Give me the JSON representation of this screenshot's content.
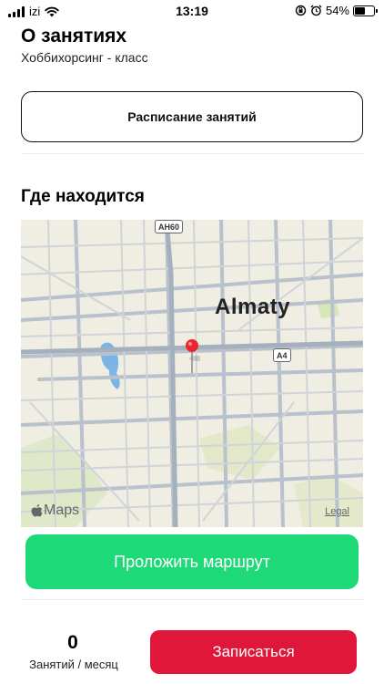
{
  "status_bar": {
    "carrier": "izi",
    "time": "13:19",
    "battery_percent": "54%",
    "battery_level": 0.54,
    "icons": [
      "signal-icon",
      "wifi-icon",
      "orientation-lock-icon",
      "alarm-icon",
      "battery-icon"
    ]
  },
  "about": {
    "title": "О занятиях",
    "subtitle": "Хоббихорсинг - класс",
    "schedule_button": "Расписание занятий"
  },
  "location": {
    "title": "Где находится",
    "map": {
      "city": "Almaty",
      "road_shields": [
        "AH60",
        "A4"
      ],
      "provider": "Maps",
      "legal": "Legal"
    },
    "route_button": "Проложить маршрут"
  },
  "footer": {
    "lessons_count": "0",
    "lessons_label": "Занятий / месяц",
    "signup_button": "Записаться"
  },
  "colors": {
    "route_green": "#1ed977",
    "signup_red": "#e0173b",
    "pin_red": "#e8262f",
    "map_bg": "#f0ede2"
  }
}
